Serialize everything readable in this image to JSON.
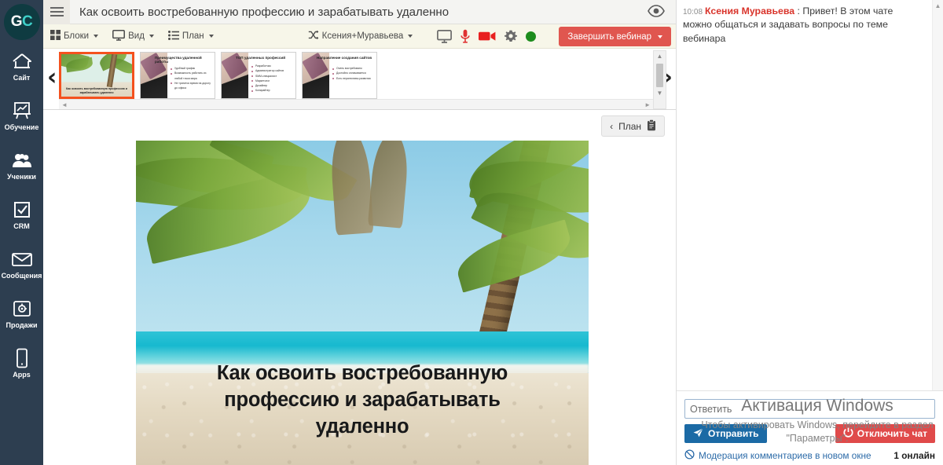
{
  "sidebar": {
    "logo": {
      "part1": "G",
      "part2": "C",
      "name": "getcourse-logo"
    },
    "items": [
      {
        "icon": "house-icon",
        "label": "Сайт"
      },
      {
        "icon": "easel-chart-icon",
        "label": "Обучение"
      },
      {
        "icon": "people-icon",
        "label": "Ученики"
      },
      {
        "icon": "checkbox-icon",
        "label": "CRM"
      },
      {
        "icon": "envelope-icon",
        "label": "Сообщения"
      },
      {
        "icon": "safe-icon",
        "label": "Продажи"
      },
      {
        "icon": "phone-icon",
        "label": "Apps"
      }
    ]
  },
  "header": {
    "menu_icon": "hamburger-icon",
    "title": "Как освоить востребованную профессию и зарабатывать удаленно",
    "preview_icon": "eye-icon"
  },
  "toolbar": {
    "menus": [
      {
        "icon": "grid-blocks-icon",
        "label": "Блоки"
      },
      {
        "icon": "monitor-icon",
        "label": "Вид"
      },
      {
        "icon": "list-icon",
        "label": "План"
      }
    ],
    "presenter": {
      "icon": "shuffle-icon",
      "label": "Ксения+Муравьева"
    },
    "status_icons": [
      {
        "name": "screen-share-icon",
        "color": "#6b6b6b"
      },
      {
        "name": "microphone-icon",
        "color": "#e03131"
      },
      {
        "name": "camera-icon",
        "color": "#e82020"
      },
      {
        "name": "gear-icon",
        "color": "#6b6b6b"
      },
      {
        "name": "connection-status-dot",
        "color": "#1d8c1d"
      }
    ],
    "end_button": "Завершить вебинар"
  },
  "slide_strip": {
    "prev_arrow": "‹",
    "next_arrow": "›",
    "scroll_up": "▲",
    "scroll_down": "▼",
    "scroll_left": "◄",
    "scroll_right": "►",
    "thumbnails": [
      {
        "type": "beach",
        "selected": true,
        "caption": "Как освоить востребованную профессию и зарабатывать удаленно"
      },
      {
        "type": "doc",
        "selected": false,
        "heading": "Преимущества удаленной работы",
        "bullets": [
          "Удобный график",
          "Возможность работать из любой точки мира",
          "Не тратится время на дорогу до офиса"
        ]
      },
      {
        "type": "doc",
        "selected": false,
        "heading": "ТОП удаленных профессий",
        "bullets": [
          "Разработчик",
          "Администратор сайтов",
          "SMM-специалист",
          "Маркетолог",
          "Дизайнер",
          "Копирайтер"
        ]
      },
      {
        "type": "doc",
        "selected": false,
        "heading": "Направление создания сайтов",
        "bullets": [
          "Очень востребовано",
          "Достойно оплачивается",
          "Есть перспективы развития"
        ]
      }
    ]
  },
  "stage": {
    "plan_button": {
      "arrow": "‹",
      "label": "План",
      "icon": "clipboard-icon"
    },
    "slide": {
      "title_lines": [
        "Как освоить востребованную",
        "профессию и зарабатывать",
        "удаленно"
      ],
      "image_alt": "tropical-beach-palm-tree"
    }
  },
  "chat": {
    "messages": [
      {
        "time": "10:08",
        "author": "Ксения Муравьева",
        "separator": " : ",
        "text": "Привет! В этом чате можно общаться и задавать вопросы по теме вебинара"
      }
    ],
    "input_placeholder": "Ответить",
    "input_value": "",
    "send_button": "Отправить",
    "disable_button": "Отключить чат",
    "moderation_link": "Модерация комментариев в новом окне",
    "online_count": "1 онлайн",
    "icons": {
      "send": "paper-plane-icon",
      "power": "power-icon",
      "block": "no-entry-icon"
    }
  },
  "watermark": {
    "line1": "Активация Windows",
    "line2": "Чтобы активировать Windows, перейдите в раздел \"Параметры\"."
  },
  "colors": {
    "sidebar_bg": "#2d3e50",
    "toolbar_bg": "#f7f6e9",
    "header_bg": "#f4f4f2",
    "accent_red": "#e0564f",
    "accent_blue": "#1b6aa5",
    "author_red": "#d9342b",
    "selected_thumb": "#f4511e",
    "status_green": "#1d8c1d",
    "logo_teal": "#3fd0c9"
  }
}
